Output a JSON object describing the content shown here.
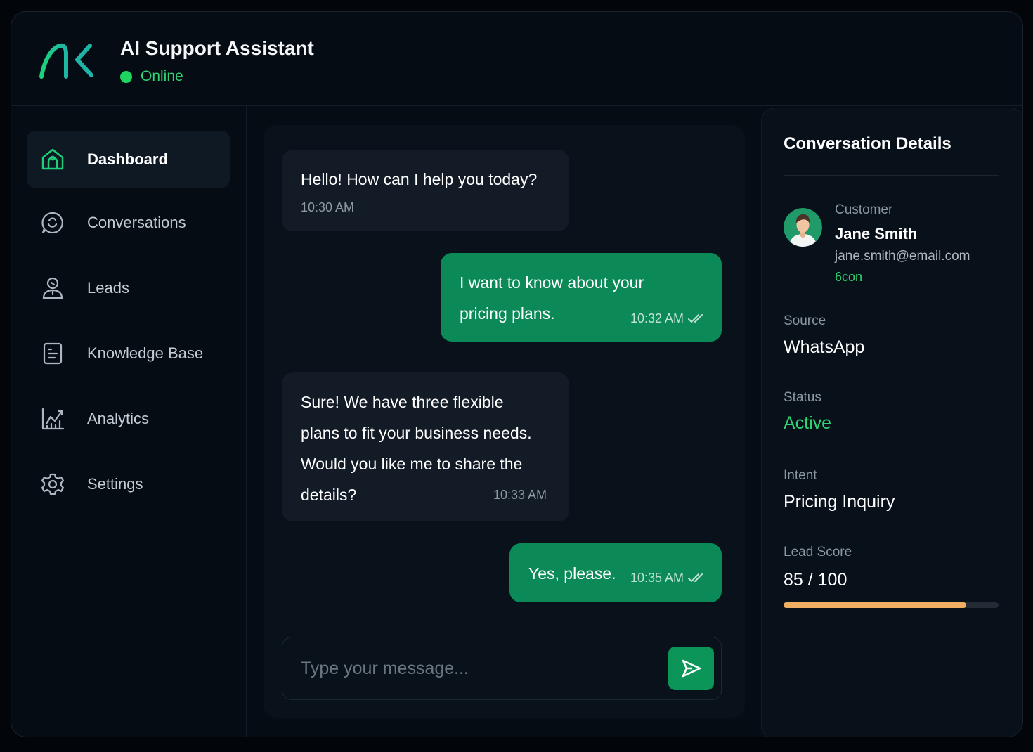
{
  "app": {
    "title": "AI Support Assistant",
    "status": "Online",
    "accent_color": "#0b8a57",
    "status_color": "#1fd55f"
  },
  "sidebar": {
    "items": [
      {
        "label": "Dashboard",
        "icon": "home-icon",
        "active": true
      },
      {
        "label": "Conversations",
        "icon": "chat-icon",
        "active": false
      },
      {
        "label": "Leads",
        "icon": "user-icon",
        "active": false
      },
      {
        "label": "Knowledge Base",
        "icon": "document-icon",
        "active": false
      },
      {
        "label": "Analytics",
        "icon": "chart-icon",
        "active": false
      },
      {
        "label": "Settings",
        "icon": "gear-icon",
        "active": false
      }
    ]
  },
  "chat": {
    "messages": [
      {
        "direction": "incoming",
        "text": "Hello! How can I help you today?",
        "time": "10:30 AM"
      },
      {
        "direction": "outgoing",
        "text_line1": "I want to know about your",
        "text_line2": "pricing plans.",
        "time": "10:32 AM",
        "read": true
      },
      {
        "direction": "incoming",
        "text_line1": "Sure! We have three flexible",
        "text_line2": "plans to fit your business needs.",
        "text_line3": "Would you like me to share the",
        "text_line4": "details?",
        "time": "10:33 AM"
      },
      {
        "direction": "outgoing",
        "text": "Yes, please.",
        "time": "10:35 AM",
        "read": true
      }
    ],
    "composer": {
      "placeholder": "Type your message...",
      "value": ""
    }
  },
  "details": {
    "title": "Conversation Details",
    "customer": {
      "label": "Customer",
      "name": "Jane Smith",
      "email": "jane.smith@email.com",
      "tag": "6con"
    },
    "source": {
      "label": "Source",
      "value": "WhatsApp"
    },
    "status": {
      "label": "Status",
      "value": "Active"
    },
    "intent": {
      "label": "Intent",
      "value": "Pricing Inquiry"
    },
    "lead_score": {
      "label": "Lead Score",
      "text": "85 / 100",
      "value": 85,
      "max": 100,
      "bar_color": "#f0ae62"
    }
  }
}
